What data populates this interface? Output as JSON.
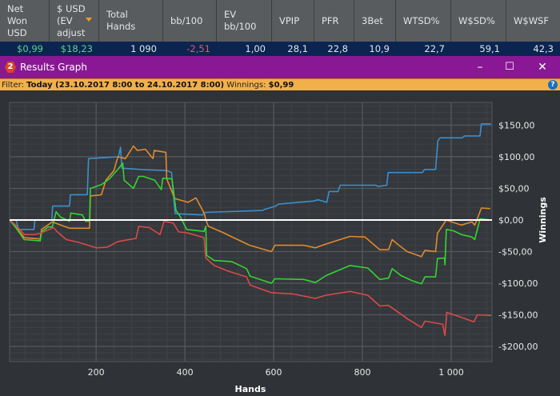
{
  "table": {
    "headers": [
      "Net\nWon\nUSD",
      "$ USD\n(EV\nadjust",
      "Total\nHands",
      "bb/100",
      "EV\nbb/100",
      "VPIP",
      "PFR",
      "3Bet",
      "WTSD%",
      "W$SD%",
      "W$WSF"
    ],
    "values": [
      "$0,99",
      "$18,23",
      "1 090",
      "-2,51",
      "1,00",
      "28,1",
      "22,8",
      "10,9",
      "22,7",
      "59,1",
      "42,3"
    ]
  },
  "window": {
    "badge": "2",
    "title": "Results Graph",
    "minimize": "–",
    "maximize": "☐",
    "close": "✕"
  },
  "filter": {
    "label": "Filter:",
    "range": "Today (23.10.2017 8:00 to 24.10.2017 8:00)",
    "winnings_label": "Winnings:",
    "winnings": "$0,99",
    "help": "?"
  },
  "chart_data": {
    "type": "line",
    "xlabel": "Hands",
    "ylabel": "Winnings",
    "xlim": [
      5,
      1092
    ],
    "ylim": [
      -224,
      186
    ],
    "xticks": [
      200,
      400,
      600,
      800,
      1000
    ],
    "xtick_labels": [
      "200",
      "400",
      "600",
      "800",
      "1 000"
    ],
    "yticks": [
      150,
      100,
      50,
      0,
      -50,
      -100,
      -150,
      -200
    ],
    "ytick_labels": [
      "$150,00",
      "$100,00",
      "$50,00",
      "$0,00",
      "-$50,00",
      "-$100,00",
      "-$150,00",
      "-$200,00"
    ],
    "grid": true,
    "series": [
      {
        "name": "blue",
        "color": "#3d8fcc",
        "points": [
          [
            5,
            0
          ],
          [
            20,
            0
          ],
          [
            25,
            -15
          ],
          [
            60,
            -15
          ],
          [
            62,
            0
          ],
          [
            100,
            0
          ],
          [
            102,
            22
          ],
          [
            140,
            22
          ],
          [
            142,
            40
          ],
          [
            180,
            40
          ],
          [
            183,
            97
          ],
          [
            250,
            100
          ],
          [
            255,
            115
          ],
          [
            258,
            82
          ],
          [
            300,
            80
          ],
          [
            360,
            78
          ],
          [
            370,
            75
          ],
          [
            372,
            55
          ],
          [
            378,
            10
          ],
          [
            440,
            8
          ],
          [
            445,
            12
          ],
          [
            575,
            15
          ],
          [
            580,
            17
          ],
          [
            605,
            22
          ],
          [
            610,
            25
          ],
          [
            690,
            30
          ],
          [
            700,
            32
          ],
          [
            720,
            28
          ],
          [
            725,
            45
          ],
          [
            745,
            45
          ],
          [
            750,
            55
          ],
          [
            830,
            55
          ],
          [
            835,
            53
          ],
          [
            855,
            55
          ],
          [
            858,
            75
          ],
          [
            935,
            75
          ],
          [
            940,
            80
          ],
          [
            965,
            80
          ],
          [
            970,
            125
          ],
          [
            975,
            130
          ],
          [
            1025,
            130
          ],
          [
            1030,
            133
          ],
          [
            1065,
            133
          ],
          [
            1068,
            152
          ],
          [
            1090,
            152
          ]
        ]
      },
      {
        "name": "orange",
        "color": "#e08a2e",
        "points": [
          [
            5,
            0
          ],
          [
            20,
            -12
          ],
          [
            38,
            -28
          ],
          [
            74,
            -30
          ],
          [
            77,
            -15
          ],
          [
            101,
            -3
          ],
          [
            120,
            -8
          ],
          [
            140,
            -13
          ],
          [
            185,
            -13
          ],
          [
            187,
            38
          ],
          [
            212,
            40
          ],
          [
            222,
            63
          ],
          [
            240,
            78
          ],
          [
            249,
            100
          ],
          [
            266,
            97
          ],
          [
            284,
            117
          ],
          [
            293,
            110
          ],
          [
            311,
            112
          ],
          [
            328,
            97
          ],
          [
            331,
            110
          ],
          [
            357,
            107
          ],
          [
            359,
            65
          ],
          [
            377,
            34
          ],
          [
            407,
            28
          ],
          [
            425,
            35
          ],
          [
            444,
            10
          ],
          [
            447,
            0
          ],
          [
            453,
            -10
          ],
          [
            483,
            -19
          ],
          [
            546,
            -40
          ],
          [
            595,
            -50
          ],
          [
            603,
            -40
          ],
          [
            668,
            -40
          ],
          [
            694,
            -44
          ],
          [
            718,
            -38
          ],
          [
            772,
            -26
          ],
          [
            806,
            -27
          ],
          [
            839,
            -47
          ],
          [
            859,
            -47
          ],
          [
            867,
            -31
          ],
          [
            877,
            -37
          ],
          [
            901,
            -50
          ],
          [
            933,
            -58
          ],
          [
            941,
            -48
          ],
          [
            965,
            -50
          ],
          [
            969,
            -21
          ],
          [
            989,
            0
          ],
          [
            1005,
            -4
          ],
          [
            1023,
            -8
          ],
          [
            1047,
            -3
          ],
          [
            1053,
            -8
          ],
          [
            1059,
            2
          ],
          [
            1068,
            19
          ],
          [
            1088,
            18
          ]
        ]
      },
      {
        "name": "green",
        "color": "#33d433",
        "points": [
          [
            5,
            0
          ],
          [
            20,
            -13
          ],
          [
            38,
            -31
          ],
          [
            74,
            -33
          ],
          [
            77,
            -19
          ],
          [
            92,
            -11
          ],
          [
            101,
            -11
          ],
          [
            110,
            13
          ],
          [
            119,
            5
          ],
          [
            140,
            -2
          ],
          [
            143,
            11
          ],
          [
            169,
            8
          ],
          [
            176,
            -2
          ],
          [
            185,
            -2
          ],
          [
            187,
            50
          ],
          [
            212,
            56
          ],
          [
            230,
            65
          ],
          [
            250,
            81
          ],
          [
            260,
            90
          ],
          [
            263,
            63
          ],
          [
            284,
            50
          ],
          [
            296,
            69
          ],
          [
            306,
            69
          ],
          [
            332,
            63
          ],
          [
            347,
            48
          ],
          [
            350,
            66
          ],
          [
            371,
            65
          ],
          [
            380,
            15
          ],
          [
            389,
            6
          ],
          [
            404,
            -15
          ],
          [
            443,
            -18
          ],
          [
            447,
            -10
          ],
          [
            449,
            -56
          ],
          [
            466,
            -64
          ],
          [
            506,
            -66
          ],
          [
            539,
            -77
          ],
          [
            547,
            -89
          ],
          [
            595,
            -100
          ],
          [
            603,
            -93
          ],
          [
            668,
            -94
          ],
          [
            694,
            -99
          ],
          [
            718,
            -88
          ],
          [
            772,
            -72
          ],
          [
            812,
            -76
          ],
          [
            839,
            -94
          ],
          [
            859,
            -92
          ],
          [
            867,
            -77
          ],
          [
            887,
            -88
          ],
          [
            912,
            -96
          ],
          [
            933,
            -101
          ],
          [
            941,
            -90
          ],
          [
            965,
            -90
          ],
          [
            969,
            -61
          ],
          [
            985,
            -60
          ],
          [
            986,
            -71
          ],
          [
            989,
            -15
          ],
          [
            1005,
            -17
          ],
          [
            1023,
            -23
          ],
          [
            1047,
            -27
          ],
          [
            1053,
            -31
          ],
          [
            1059,
            -15
          ],
          [
            1065,
            2
          ],
          [
            1088,
            0
          ]
        ]
      },
      {
        "name": "red",
        "color": "#d94a4a",
        "points": [
          [
            5,
            0
          ],
          [
            20,
            -9
          ],
          [
            38,
            -23
          ],
          [
            61,
            -23
          ],
          [
            74,
            -21
          ],
          [
            104,
            -12
          ],
          [
            113,
            -19
          ],
          [
            133,
            -31
          ],
          [
            158,
            -35
          ],
          [
            182,
            -40
          ],
          [
            200,
            -44
          ],
          [
            225,
            -43
          ],
          [
            249,
            -34
          ],
          [
            290,
            -29
          ],
          [
            296,
            -10
          ],
          [
            320,
            -12
          ],
          [
            344,
            -23
          ],
          [
            353,
            -2
          ],
          [
            374,
            -5
          ],
          [
            386,
            -19
          ],
          [
            404,
            -20
          ],
          [
            443,
            -28
          ],
          [
            447,
            -60
          ],
          [
            466,
            -72
          ],
          [
            498,
            -81
          ],
          [
            539,
            -90
          ],
          [
            547,
            -103
          ],
          [
            595,
            -115
          ],
          [
            644,
            -117
          ],
          [
            694,
            -124
          ],
          [
            718,
            -119
          ],
          [
            772,
            -113
          ],
          [
            812,
            -119
          ],
          [
            839,
            -136
          ],
          [
            859,
            -135
          ],
          [
            877,
            -144
          ],
          [
            901,
            -156
          ],
          [
            933,
            -170
          ],
          [
            941,
            -160
          ],
          [
            981,
            -165
          ],
          [
            986,
            -183
          ],
          [
            990,
            -146
          ],
          [
            1027,
            -155
          ],
          [
            1051,
            -161
          ],
          [
            1059,
            -150
          ],
          [
            1090,
            -151
          ]
        ]
      }
    ]
  }
}
